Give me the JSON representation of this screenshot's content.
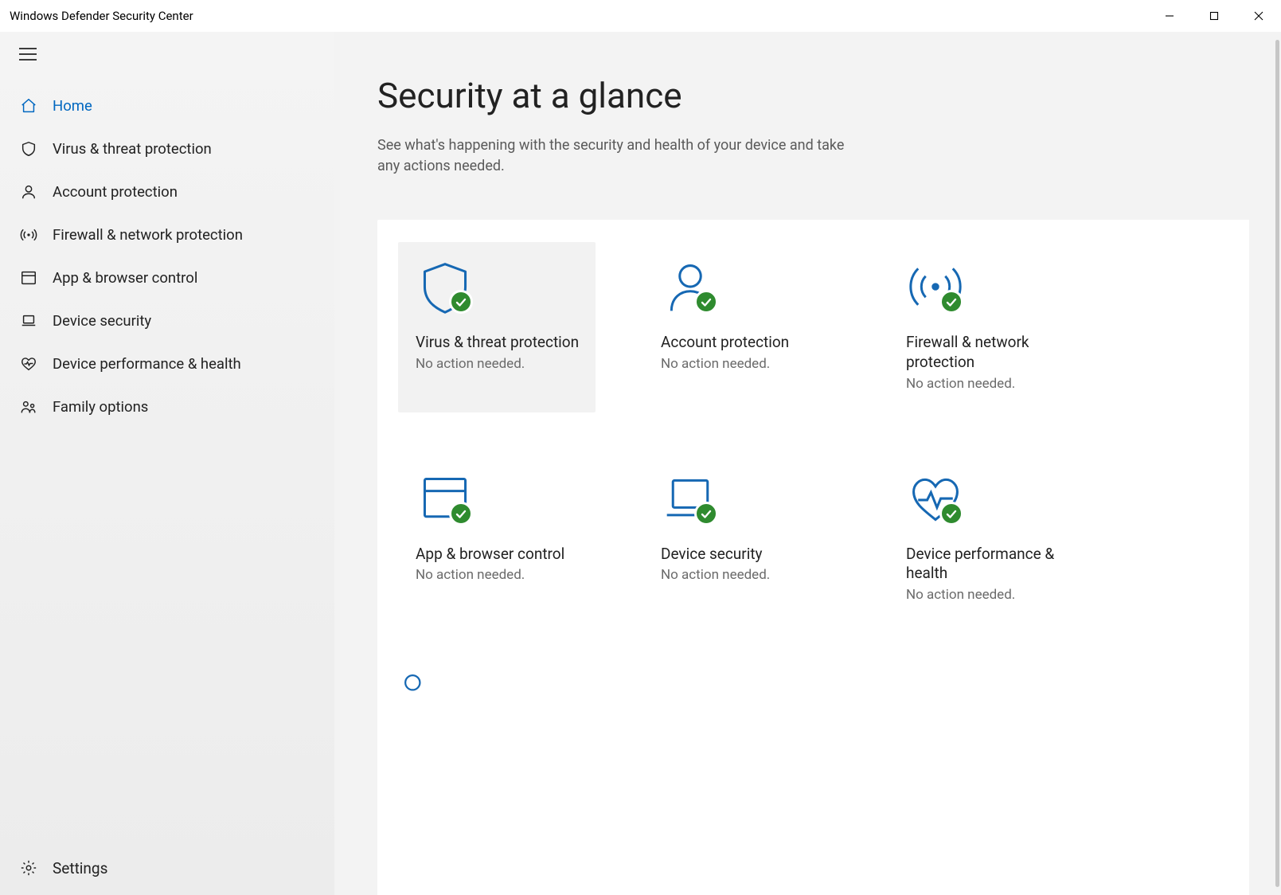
{
  "window": {
    "title": "Windows Defender Security Center"
  },
  "sidebar": {
    "items": [
      {
        "label": "Home",
        "icon": "home-icon",
        "active": true
      },
      {
        "label": "Virus & threat protection",
        "icon": "shield-icon",
        "active": false
      },
      {
        "label": "Account protection",
        "icon": "person-icon",
        "active": false
      },
      {
        "label": "Firewall & network protection",
        "icon": "antenna-icon",
        "active": false
      },
      {
        "label": "App & browser control",
        "icon": "browser-icon",
        "active": false
      },
      {
        "label": "Device security",
        "icon": "laptop-icon",
        "active": false
      },
      {
        "label": "Device performance & health",
        "icon": "heart-icon",
        "active": false
      },
      {
        "label": "Family options",
        "icon": "family-icon",
        "active": false
      }
    ],
    "settings_label": "Settings"
  },
  "main": {
    "title": "Security at a glance",
    "subtitle": "See what's happening with the security and health of your device and take any actions needed."
  },
  "cards": [
    {
      "title": "Virus & threat protection",
      "status": "No action needed.",
      "icon": "shield-icon",
      "hover": true
    },
    {
      "title": "Account protection",
      "status": "No action needed.",
      "icon": "person-icon",
      "hover": false
    },
    {
      "title": "Firewall & network protection",
      "status": "No action needed.",
      "icon": "antenna-icon",
      "hover": false
    },
    {
      "title": "App & browser control",
      "status": "No action needed.",
      "icon": "browser-icon",
      "hover": false
    },
    {
      "title": "Device security",
      "status": "No action needed.",
      "icon": "laptop-icon",
      "hover": false
    },
    {
      "title": "Device performance & health",
      "status": "No action needed.",
      "icon": "heart-icon",
      "hover": false
    }
  ],
  "colors": {
    "accent": "#0067c0",
    "icon_blue": "#0a66b7",
    "status_ok": "#2f8b2f",
    "muted_text": "#6b6b6b"
  }
}
